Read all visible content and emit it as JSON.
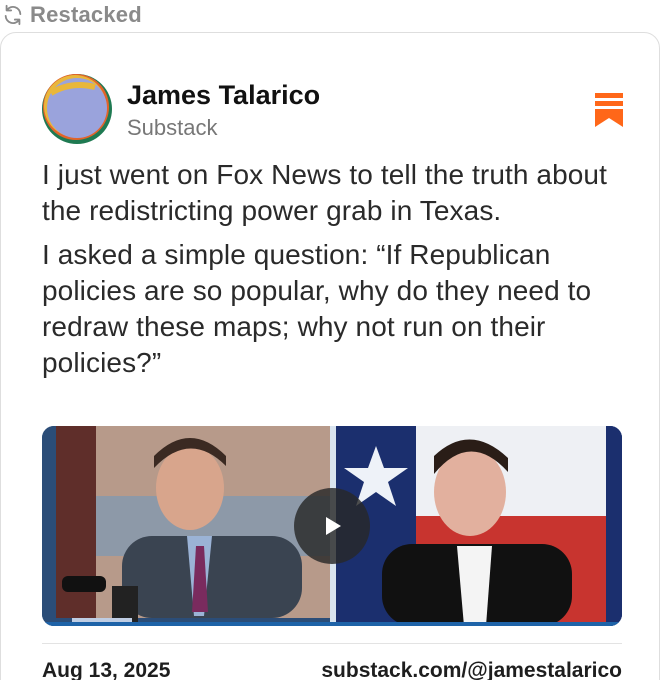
{
  "restacked": {
    "label": "Restacked",
    "icon": "restack-icon"
  },
  "post": {
    "author_name": "James Talarico",
    "publication": "Substack",
    "paragraphs": [
      "I just went on Fox News to tell the truth about the redistricting power grab in Texas.",
      "I asked a simple question: “If Republican policies are so popular, why do they need to redraw these maps; why not run on their policies?”"
    ],
    "bookmark_icon": "bookmark-icon",
    "video_play_icon": "play-icon",
    "date": "Aug 13, 2025",
    "link": "substack.com/@jamestalarico"
  },
  "colors": {
    "accent": "#ff6719",
    "muted_text": "#8a8a8a",
    "body_text": "#2a2a2a",
    "video_frame": "#0f3a6e"
  }
}
